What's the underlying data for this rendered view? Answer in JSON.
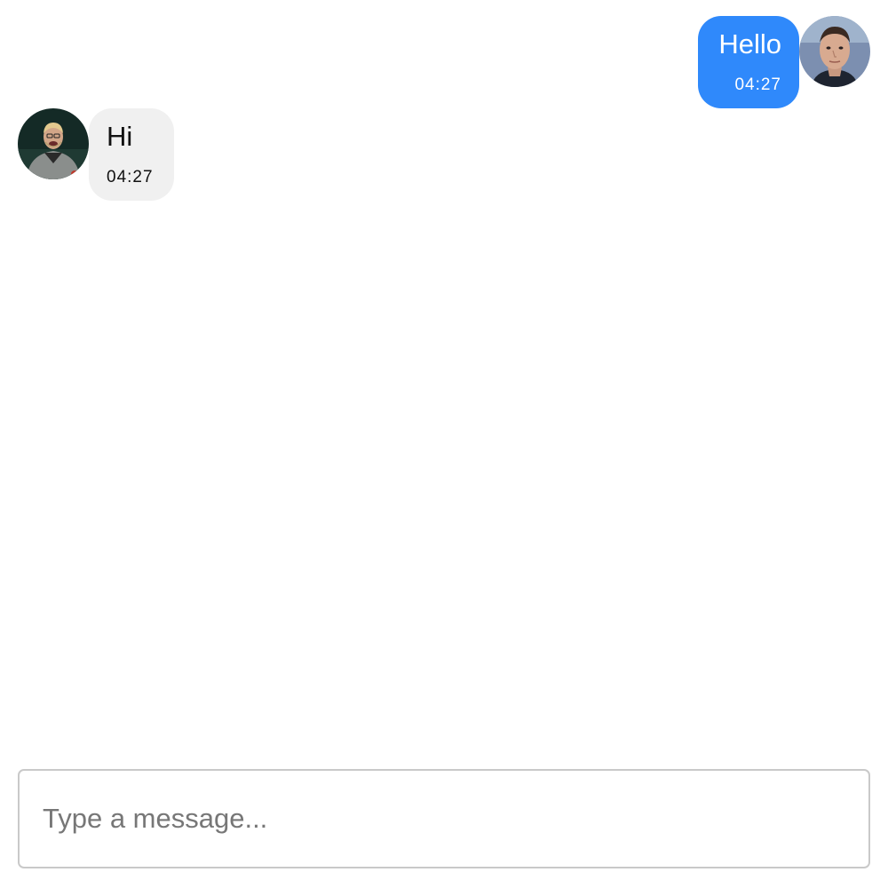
{
  "messages": [
    {
      "direction": "outgoing",
      "text": "Hello",
      "time": "04:27",
      "avatar_icon": "avatar-photo-icon",
      "bubble_color": "#2f89fb"
    },
    {
      "direction": "incoming",
      "text": "Hi",
      "time": "04:27",
      "avatar_icon": "avatar-photo-icon",
      "bubble_color": "#f0f0f0"
    }
  ],
  "composer": {
    "placeholder": "Type a message...",
    "value": ""
  }
}
